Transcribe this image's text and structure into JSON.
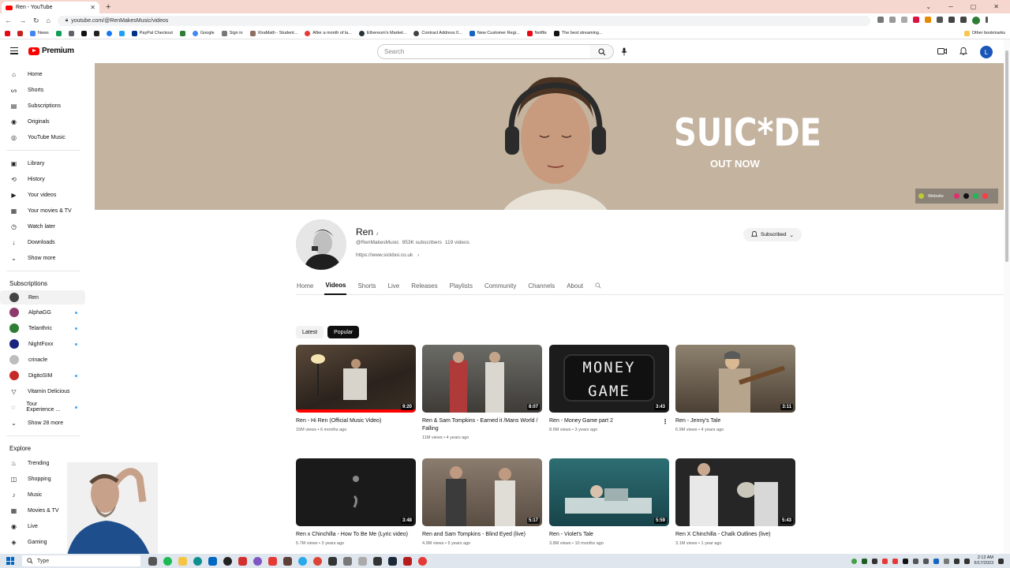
{
  "browser": {
    "tab_title": "Ren - YouTube",
    "new_tab": "+",
    "url": "youtube.com/@RenMakesMusic/videos",
    "bookmarks": [
      "News",
      "PayPal Checkout",
      "Google",
      "Sign in",
      "XtraMath - Student...",
      "After a month of la...",
      "Ethereum's Market...",
      "Contract Address 0...",
      "New Customer Regi...",
      "Netflix",
      "The best streaming..."
    ],
    "other_bookmarks": "Other bookmarks"
  },
  "header": {
    "logo_text": "Premium",
    "search_placeholder": "Search",
    "avatar_letter": "L"
  },
  "sidebar": {
    "main": [
      "Home",
      "Shorts",
      "Subscriptions",
      "Originals",
      "YouTube Music"
    ],
    "library": [
      "Library",
      "History",
      "Your videos",
      "Your movies & TV",
      "Watch later",
      "Downloads",
      "Show more"
    ],
    "subscriptions_heading": "Subscriptions",
    "subscriptions": [
      "Ren",
      "AlphaGG",
      "Telanthric",
      "NightFoxx",
      "crinacle",
      "DigitoSIM",
      "Vitamin Delicious",
      "Tour Experience ...",
      "Show 28 more"
    ],
    "explore_heading": "Explore",
    "explore": [
      "Trending",
      "Shopping",
      "Music",
      "Movies & TV",
      "Live",
      "Gaming"
    ]
  },
  "banner": {
    "title": "SUIC*DE",
    "subtitle": "OUT NOW",
    "website_label": "Website"
  },
  "channel": {
    "name": "Ren",
    "name_badge": "♪",
    "handle": "@RenMakesMusic",
    "subscribers": "953K subscribers",
    "videos": "119 videos",
    "link": "https://www.sickboi.co.uk",
    "subscribe_label": "Subscribed",
    "tabs": [
      "Home",
      "Videos",
      "Shorts",
      "Live",
      "Releases",
      "Playlists",
      "Community",
      "Channels",
      "About"
    ]
  },
  "chips": [
    "Latest",
    "Popular"
  ],
  "videos": [
    {
      "title": "Ren - Hi Ren (Official Music Video)",
      "meta": "15M views • 6 months ago",
      "duration": "9:20"
    },
    {
      "title": "Ren & Sam Tompkins - Earned it /Mans World / Falling",
      "meta": "11M views • 4 years ago",
      "duration": "8:07"
    },
    {
      "title": "Ren - Money Game part 2",
      "meta": "8.6M views • 3 years ago",
      "duration": "3:43",
      "thumb_text": "MONEY GAME"
    },
    {
      "title": "Ren - Jenny's Tale",
      "meta": "6.9M views • 4 years ago",
      "duration": "3:11"
    },
    {
      "title": "Ren x Chinchilla - How To Be Me (Lyric video)",
      "meta": "5.7M views • 3 years ago",
      "duration": "3:48"
    },
    {
      "title": "Ren and Sam Tompkins - Blind Eyed (live)",
      "meta": "4.9M views • 5 years ago",
      "duration": "5:17"
    },
    {
      "title": "Ren - Violet's Tale",
      "meta": "3.8M views • 10 months ago",
      "duration": "5:59"
    },
    {
      "title": "Ren X Chinchilla - Chalk Outlines (live)",
      "meta": "3.1M views • 1 year ago",
      "duration": "5:43"
    }
  ],
  "taskbar": {
    "search_text": "Type",
    "time": "2:12 AM",
    "date": "6/17/2023"
  },
  "colors": {
    "brand_red": "#ff0000",
    "banner_bg": "#c4b39f",
    "link_blue": "#3ea6ff"
  }
}
